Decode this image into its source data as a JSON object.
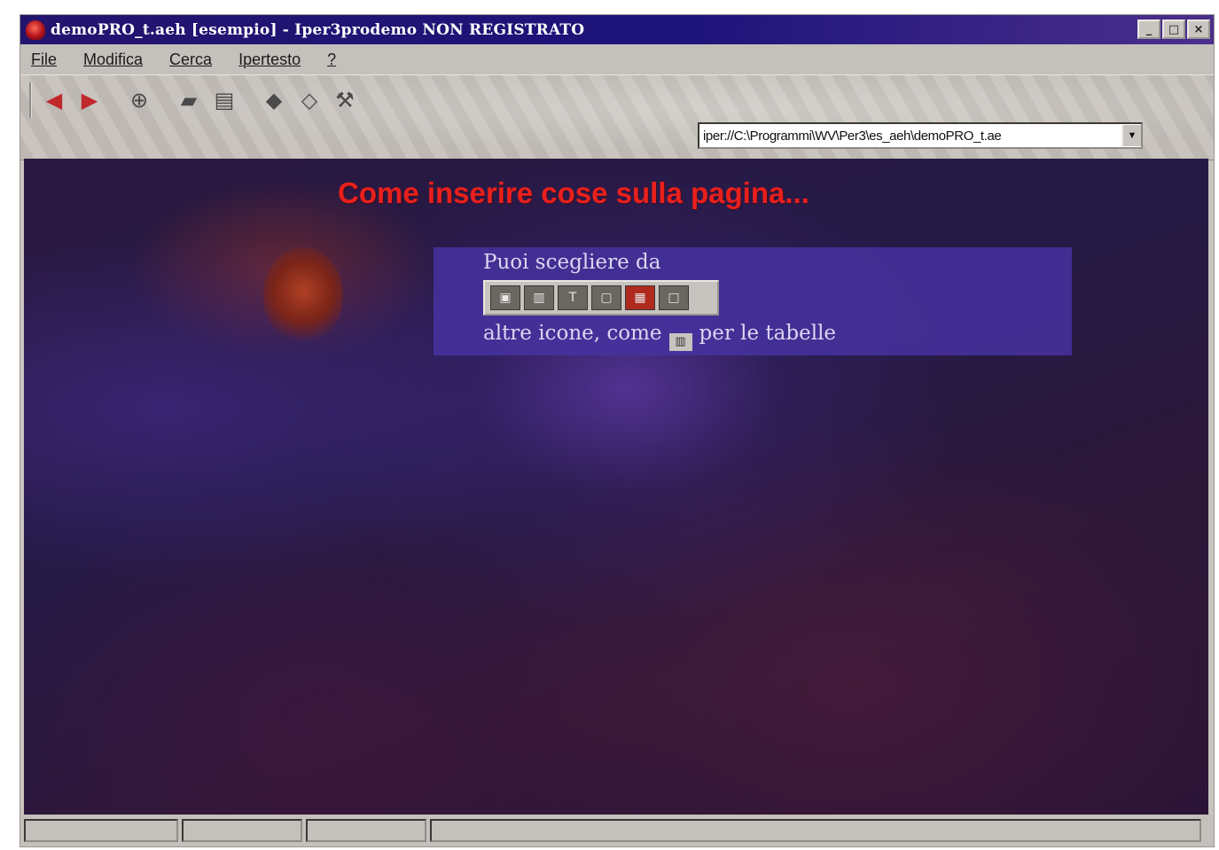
{
  "window": {
    "title": "demoPRO_t.aeh [esempio] - Iper3prodemo NON REGISTRATO",
    "controls": [
      "_",
      "□",
      "×"
    ]
  },
  "menu": [
    "File",
    "Modifica",
    "Cerca",
    "Ipertesto",
    "?"
  ],
  "toolbar": {
    "buttons": [
      "back-icon",
      "forward-icon",
      "globe-icon",
      "open-folder-icon",
      "print-icon",
      "stack-icon",
      "eraser-icon",
      "tools-icon"
    ]
  },
  "address": {
    "value": "iper://C:\\Programmi\\WV\\Per3\\es_aeh\\demoPRO_t.ae"
  },
  "content": {
    "heading": "Come inserire cose sulla pagina...",
    "choose_label": "Puoi scegliere da",
    "strip_icons": [
      "image-icon",
      "table-icon",
      "text-icon",
      "frame-icon",
      "colored-block-icon",
      "box-icon"
    ],
    "other_before": "altre icone, come",
    "other_after": "per le tabelle"
  },
  "statusbar": {
    "panes": [
      "",
      "",
      "",
      ""
    ]
  }
}
